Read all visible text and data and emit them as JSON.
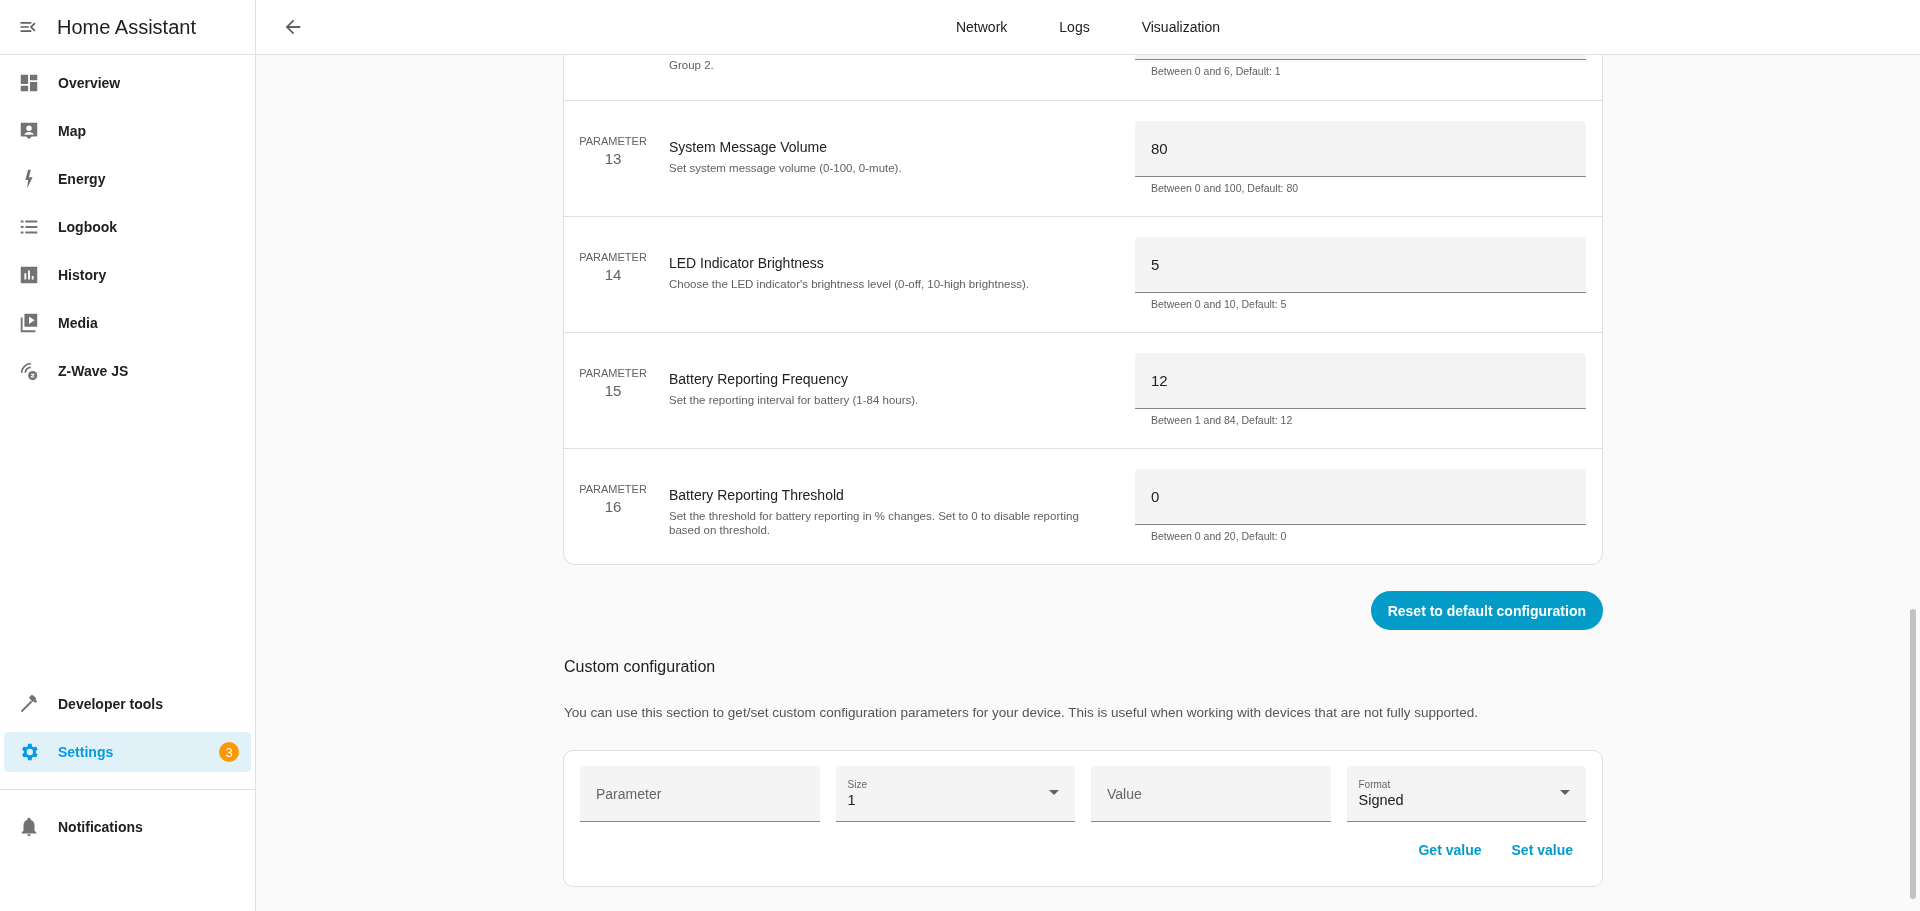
{
  "sidebar": {
    "title": "Home Assistant",
    "items": [
      {
        "label": "Overview",
        "kind": "dashboard",
        "selected": false
      },
      {
        "label": "Map",
        "kind": "map",
        "selected": false
      },
      {
        "label": "Energy",
        "kind": "bolt",
        "selected": false
      },
      {
        "label": "Logbook",
        "kind": "list",
        "selected": false
      },
      {
        "label": "History",
        "kind": "chart",
        "selected": false
      },
      {
        "label": "Media",
        "kind": "media",
        "selected": false
      },
      {
        "label": "Z-Wave JS",
        "kind": "zwave",
        "selected": false
      }
    ],
    "bottom_items": [
      {
        "label": "Developer tools",
        "kind": "hammer",
        "selected": false
      },
      {
        "label": "Settings",
        "kind": "gear",
        "selected": true,
        "badge": "3"
      }
    ],
    "notifications": {
      "label": "Notifications",
      "kind": "bell"
    }
  },
  "tabs": [
    {
      "label": "Network"
    },
    {
      "label": "Logs"
    },
    {
      "label": "Visualization"
    }
  ],
  "partial_parameter": {
    "description": "Group 2.",
    "helper": "Between 0 and 6, Default: 1"
  },
  "parameters": [
    {
      "label": "PARAMETER",
      "number": "13",
      "title": "System Message Volume",
      "description": "Set system message volume (0-100, 0-mute).",
      "value": "80",
      "helper": "Between 0 and 100, Default: 80"
    },
    {
      "label": "PARAMETER",
      "number": "14",
      "title": "LED Indicator Brightness",
      "description": "Choose the LED indicator's brightness level (0-off, 10-high brightness).",
      "value": "5",
      "helper": "Between 0 and 10, Default: 5"
    },
    {
      "label": "PARAMETER",
      "number": "15",
      "title": "Battery Reporting Frequency",
      "description": "Set the reporting interval for battery (1-84 hours).",
      "value": "12",
      "helper": "Between 1 and 84, Default: 12"
    },
    {
      "label": "PARAMETER",
      "number": "16",
      "title": "Battery Reporting Threshold",
      "description": "Set the threshold for battery reporting in % changes. Set to 0 to disable reporting based on threshold.",
      "value": "0",
      "helper": "Between 0 and 20, Default: 0"
    }
  ],
  "reset_button": "Reset to default configuration",
  "custom": {
    "title": "Custom configuration",
    "description": "You can use this section to get/set custom configuration parameters for your device. This is useful when working with devices that are not fully supported.",
    "fields": [
      {
        "kind": "text",
        "placeholder": "Parameter"
      },
      {
        "kind": "select",
        "label": "Size",
        "value": "1"
      },
      {
        "kind": "text",
        "placeholder": "Value"
      },
      {
        "kind": "select",
        "label": "Format",
        "value": "Signed"
      }
    ],
    "buttons": [
      "Get value",
      "Set value"
    ]
  }
}
